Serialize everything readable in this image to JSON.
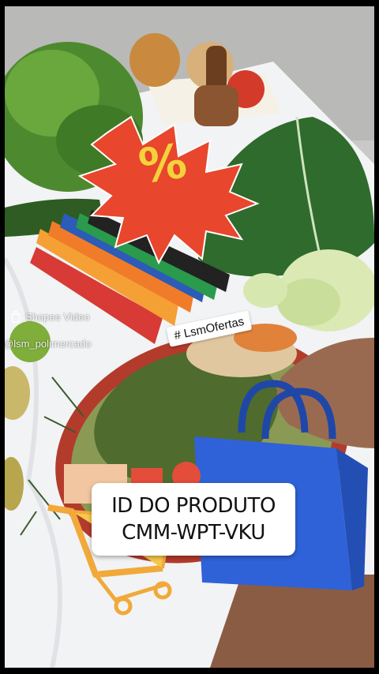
{
  "discount_badge": {
    "symbol": "%",
    "color": "#e8462d",
    "symbol_color": "#f4d23a"
  },
  "watermark": {
    "platform_icon": "shopee-bag-icon",
    "platform": "Shopee Video",
    "username": "@lsm_polimercado"
  },
  "hashtag": "# LsmOfertas",
  "product": {
    "line1": "ID DO PRODUTO",
    "line2": "CMM-WPT-VKU"
  },
  "stickers": {
    "shopping_bag_icon": "shopping-bag-icon",
    "cart_icon": "shopping-cart-icon",
    "bag_color": "#2f62d8"
  }
}
